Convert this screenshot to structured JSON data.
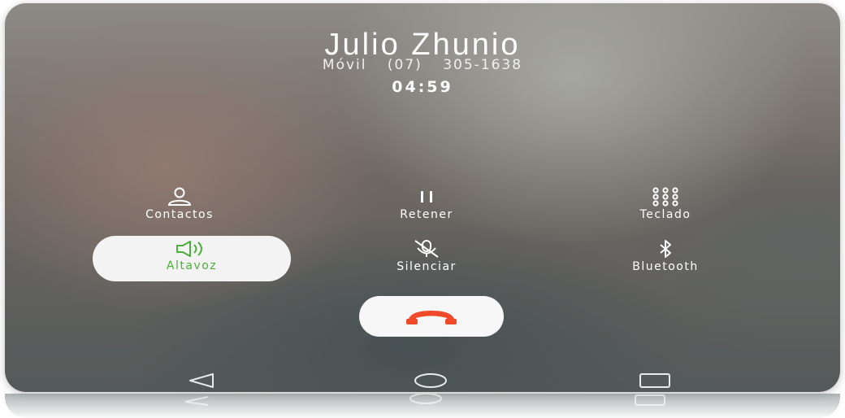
{
  "call": {
    "contact_name": "Julio Zhunio",
    "number_type": "Móvil",
    "phone_number": "(07) 305-1638",
    "duration": "04:59"
  },
  "controls": {
    "contacts_label": "Contactos",
    "hold_label": "Retener",
    "keypad_label": "Teclado",
    "speaker_label": "Altavoz",
    "mute_label": "Silenciar",
    "bluetooth_label": "Bluetooth"
  },
  "icons": {
    "contacts": "person-icon",
    "hold": "pause-icon",
    "keypad": "dialpad-icon",
    "speaker": "speaker-icon",
    "mute": "mic-off-icon",
    "bluetooth": "bluetooth-icon",
    "end_call": "hang-up-icon",
    "nav_back": "back-triangle-icon",
    "nav_home": "home-circle-icon",
    "nav_recents": "recents-square-icon"
  },
  "colors": {
    "speaker_active": "#4cae3b",
    "end_call": "#f04a2a"
  },
  "state": {
    "speaker_on": true
  }
}
